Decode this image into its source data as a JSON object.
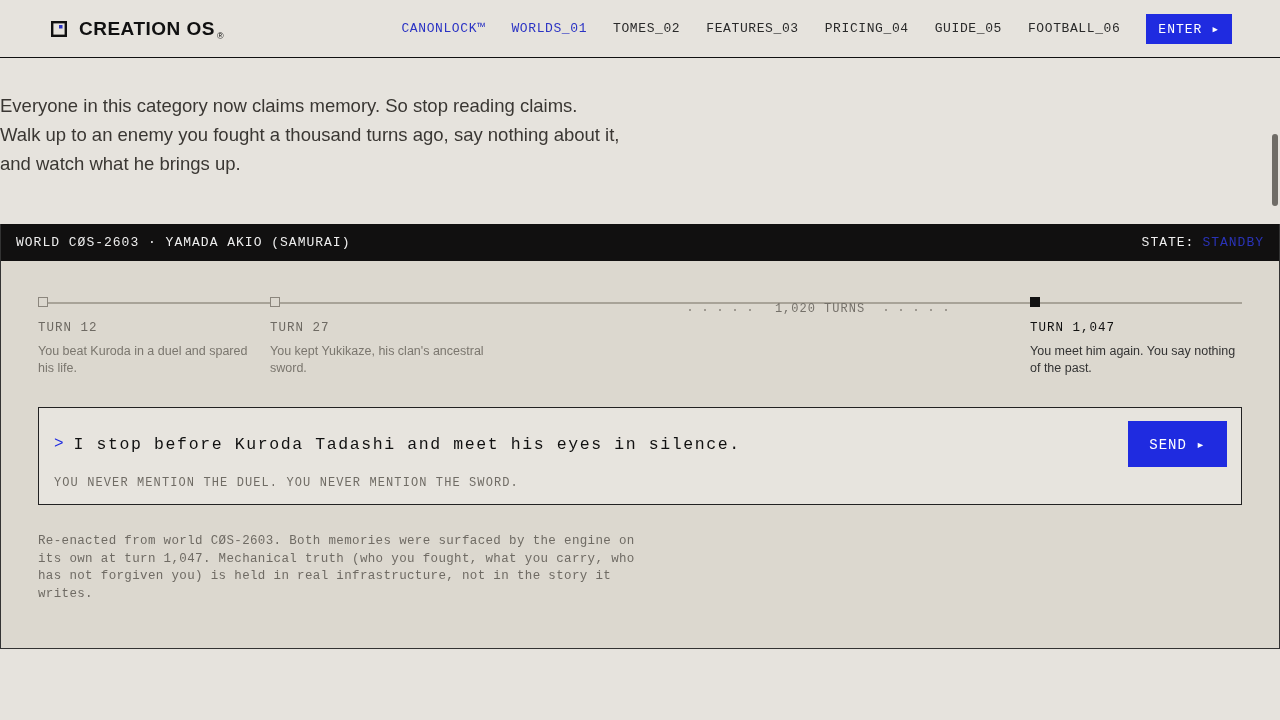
{
  "header": {
    "brand": "CREATION OS",
    "brand_mark": "®",
    "nav": [
      {
        "label": "CANONLOCK™",
        "highlighted": true
      },
      {
        "label": "WORLDS_01",
        "highlighted": true
      },
      {
        "label": "TOMES_02",
        "highlighted": false
      },
      {
        "label": "FEATURES_03",
        "highlighted": false
      },
      {
        "label": "PRICING_04",
        "highlighted": false
      },
      {
        "label": "GUIDE_05",
        "highlighted": false
      },
      {
        "label": "FOOTBALL_06",
        "highlighted": false
      }
    ],
    "cta": "ENTER ▸"
  },
  "intro": "Everyone in this category now claims memory. So stop reading claims. Walk up to an enemy you fought a thousand turns ago, say nothing about it, and watch what he brings up.",
  "panel": {
    "title": "WORLD CØS-2603 · YAMADA AKIO (SAMURAI)",
    "state_label": "STATE:",
    "state_value": "STANDBY",
    "timeline": [
      {
        "kind": "milestone",
        "turn": "TURN 12",
        "text": "You beat Kuroda in a duel and spared his life.",
        "current": false
      },
      {
        "kind": "milestone",
        "turn": "TURN 27",
        "text": "You kept Yukikaze, his clan's ancestral sword.",
        "current": false
      },
      {
        "kind": "gap",
        "label": "1,020 TURNS"
      },
      {
        "kind": "milestone",
        "turn": "TURN 1,047",
        "text": "You meet him again. You say nothing of the past.",
        "current": true
      }
    ],
    "prompt": ">",
    "input": "I stop before Kuroda Tadashi and meet his eyes in silence.",
    "send": "SEND ▸",
    "hint": "YOU NEVER MENTION THE DUEL. YOU NEVER MENTION THE SWORD.",
    "footnote": "Re-enacted from world CØS-2603. Both memories were surfaced by the engine on its own at turn 1,047. Mechanical truth (who you fought, what you carry, who has not forgiven you) is held in real infrastructure, not in the story it writes."
  }
}
